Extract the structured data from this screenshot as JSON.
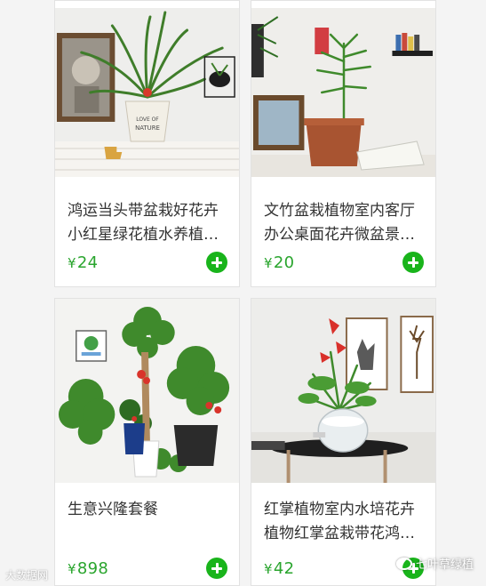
{
  "products": [
    {
      "title_line1": "鸿运当头带盆栽好花卉",
      "title_line2": "小红星绿花植水养植…",
      "currency": "¥",
      "price": "24"
    },
    {
      "title_line1": "文竹盆栽植物室内客厅",
      "title_line2": "办公桌面花卉微盆景…",
      "currency": "¥",
      "price": "20"
    },
    {
      "title_line1": "生意兴隆套餐",
      "title_line2": "",
      "currency": "¥",
      "price": "898"
    },
    {
      "title_line1": "红掌植物室内水培花卉",
      "title_line2": "植物红掌盆栽带花鸿…",
      "currency": "¥",
      "price": "42"
    }
  ],
  "watermark": {
    "left": "大数据网",
    "right": "七叶草绿植"
  },
  "colors": {
    "price": "#2aa52e",
    "add_button": "#19b41b"
  }
}
